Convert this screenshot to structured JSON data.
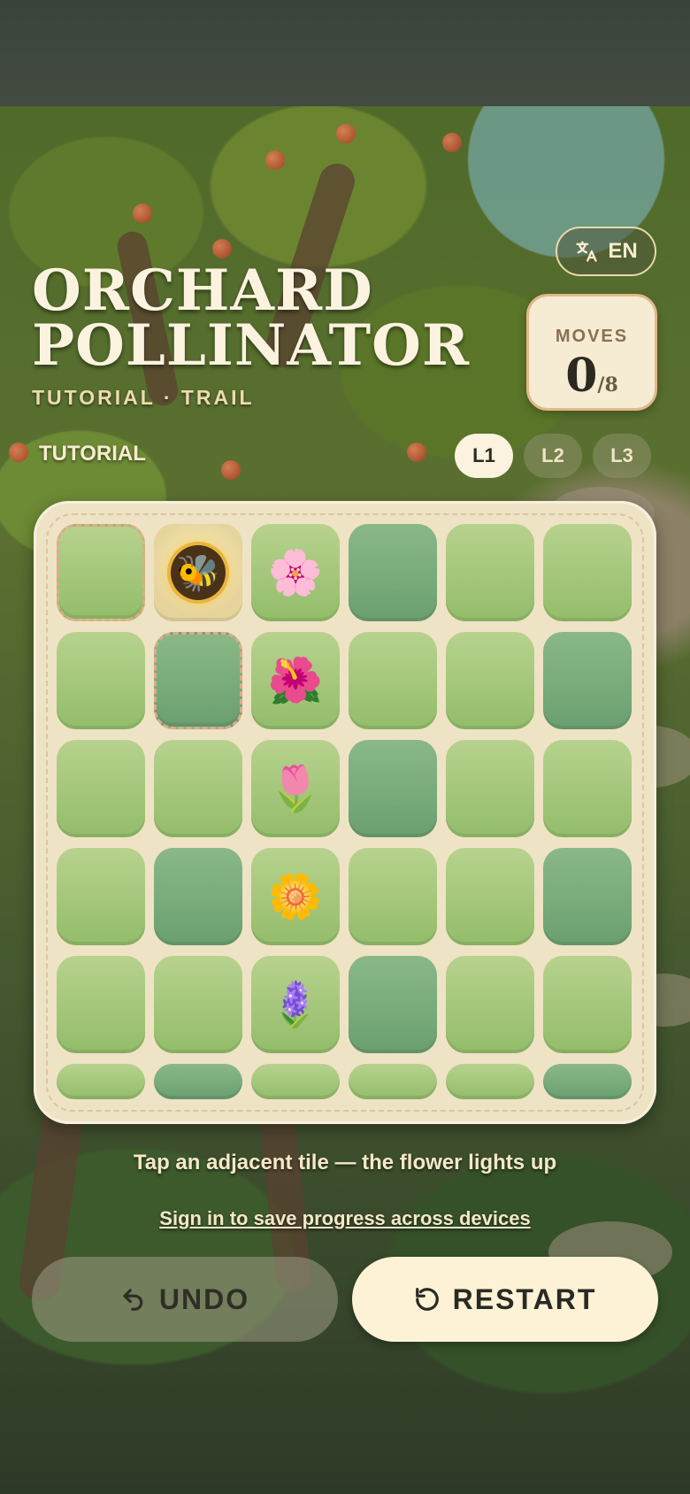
{
  "language": {
    "label": "EN",
    "icon": "translate-icon"
  },
  "title": {
    "line1": "ORCHARD",
    "line2": "POLLINATOR"
  },
  "subtitle": "TUTORIAL · TRAIL",
  "moves": {
    "label": "MOVES",
    "current": "0",
    "total": "/8"
  },
  "mode_label": "TUTORIAL",
  "levels": [
    {
      "label": "L1",
      "active": true
    },
    {
      "label": "L2",
      "active": false
    },
    {
      "label": "L3",
      "active": false
    }
  ],
  "board": {
    "rows": 6,
    "cols": 6,
    "tiles": [
      [
        "path",
        "bee",
        "flower-cherry-blossom",
        "plain",
        "plain",
        "plain"
      ],
      [
        "plain",
        "path",
        "flower-hibiscus",
        "plain",
        "plain",
        "plain"
      ],
      [
        "plain",
        "plain",
        "flower-tulip",
        "plain",
        "plain",
        "plain"
      ],
      [
        "plain",
        "plain",
        "flower-daisy",
        "plain",
        "plain",
        "plain"
      ],
      [
        "plain",
        "plain",
        "flower-hyacinth",
        "plain",
        "plain",
        "plain"
      ],
      [
        "plain",
        "plain",
        "plain",
        "plain",
        "plain",
        "plain"
      ]
    ],
    "glyphs": {
      "bee": "🐝",
      "flower-cherry-blossom": "🌸",
      "flower-hibiscus": "🌺",
      "flower-tulip": "🌷",
      "flower-daisy": "🌼",
      "flower-hyacinth": "🪻"
    }
  },
  "hint": "Tap an adjacent tile — the flower lights up",
  "signin": "Sign in to save progress across devices",
  "buttons": {
    "undo": "UNDO",
    "restart": "RESTART"
  },
  "colors": {
    "cream": "#fbf3df",
    "tile_light": "#a9cc7d",
    "tile_dark": "#7aab7a",
    "path_dash": "#e0a98a"
  }
}
